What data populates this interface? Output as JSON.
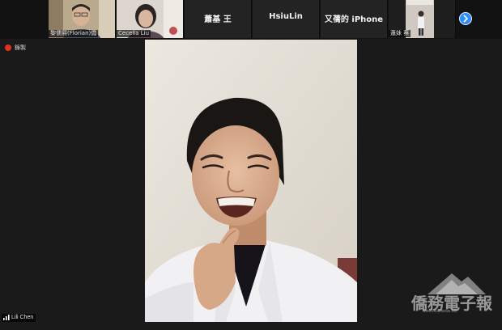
{
  "gallery": {
    "tiles": [
      {
        "name": "黎儒熙(Florian)僑"
      },
      {
        "name": "Cecelia Liu"
      },
      {
        "label": "蕭基 王"
      },
      {
        "label": "HsiuLin"
      },
      {
        "label": "又蒨的 iPhone"
      },
      {
        "name": "蓮妹 蔡"
      }
    ]
  },
  "recording": {
    "label": "錄製"
  },
  "active_speaker": {
    "name": "Lili Chen"
  },
  "watermark": {
    "main": "僑務電子報",
    "sub": "www.ocacnews.net"
  },
  "colors": {
    "accent": "#2d8cff",
    "record": "#e0321e",
    "background": "#1a1a1a"
  },
  "icons": {
    "next": "chevron-right-icon",
    "signal": "signal-bars-icon",
    "record": "record-dot-icon"
  }
}
